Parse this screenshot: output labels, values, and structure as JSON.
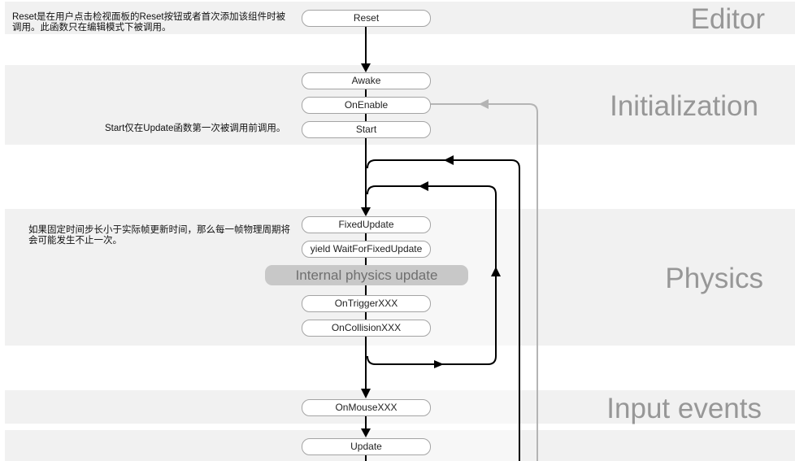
{
  "sections": [
    {
      "id": "editor",
      "title": "Editor"
    },
    {
      "id": "initialization",
      "title": "Initialization"
    },
    {
      "id": "physics",
      "title": "Physics"
    },
    {
      "id": "input",
      "title": "Input events"
    }
  ],
  "notes": {
    "reset": "Reset是在用户点击检视面板的Reset按钮或者首次添加该组件时被调用。此函数只在编辑模式下被调用。",
    "start": "Start仅在Update函数第一次被调用前调用。",
    "physics": "如果固定时间步长小于实际帧更新时间，那么每一帧物理周期将会可能发生不止一次。"
  },
  "nodes": {
    "reset": "Reset",
    "awake": "Awake",
    "onenable": "OnEnable",
    "start": "Start",
    "fixedupdate": "FixedUpdate",
    "waitforfixed": "yield WaitForFixedUpdate",
    "internal_physics": "Internal physics update",
    "ontrigger": "OnTriggerXXX",
    "oncollision": "OnCollisionXXX",
    "onmouse": "OnMouseXXX",
    "update": "Update"
  },
  "colors": {
    "band": "#f1f1f1",
    "section_title": "#979797",
    "flow_line": "#000000",
    "reenable_line": "#b4b4b4",
    "internal_pill": "#c8c8c8"
  }
}
